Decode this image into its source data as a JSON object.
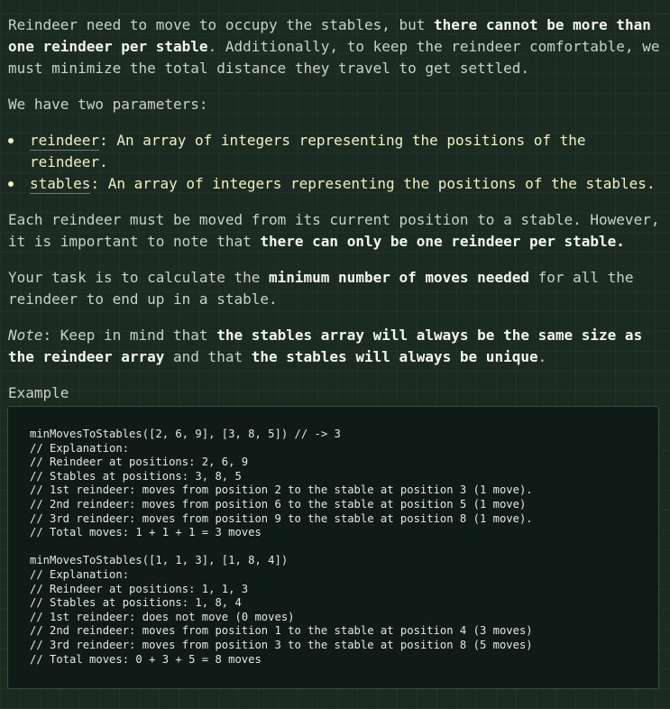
{
  "paragraph1": {
    "text_a": "Reindeer need to move to occupy the stables, but ",
    "bold_a": "there cannot be more than one reindeer per stable",
    "text_b": ". Additionally, to keep the reindeer comfortable, we must minimize the total distance they travel to get settled."
  },
  "paragraph2": {
    "text": "We have two parameters:"
  },
  "params": [
    {
      "code": "reindeer",
      "text": ": An array of integers representing the positions of the reindeer."
    },
    {
      "code": "stables",
      "text": ": An array of integers representing the positions of the stables."
    }
  ],
  "paragraph3": {
    "text_a": "Each reindeer must be moved from its current position to a stable. However, it is important to note that ",
    "bold_a": "there can only be one reindeer per stable."
  },
  "paragraph4": {
    "text_a": "Your task is to calculate the ",
    "bold_a": "minimum number of moves needed",
    "text_b": " for all the reindeer to end up in a stable."
  },
  "paragraph5": {
    "italic": "Note",
    "text_a": ": Keep in mind that ",
    "bold_a": "the stables array will always be the same size as the reindeer array",
    "text_b": " and that ",
    "bold_b": "the stables will always be unique",
    "text_c": "."
  },
  "example_label": "Example",
  "code_lines": [
    "minMovesToStables([2, 6, 9], [3, 8, 5]) // -> 3",
    "// Explanation:",
    "// Reindeer at positions: 2, 6, 9",
    "// Stables at positions: 3, 8, 5",
    "// 1st reindeer: moves from position 2 to the stable at position 3 (1 move).",
    "// 2nd reindeer: moves from position 6 to the stable at position 5 (1 move)",
    "// 3rd reindeer: moves from position 9 to the stable at position 8 (1 move).",
    "// Total moves: 1 + 1 + 1 = 3 moves",
    "",
    "minMovesToStables([1, 1, 3], [1, 8, 4])",
    "// Explanation:",
    "// Reindeer at positions: 1, 1, 3",
    "// Stables at positions: 1, 8, 4",
    "// 1st reindeer: does not move (0 moves)",
    "// 2nd reindeer: moves from position 1 to the stable at position 4 (3 moves)",
    "// 3rd reindeer: moves from position 3 to the stable at position 8 (5 moves)",
    "// Total moves: 0 + 3 + 5 = 8 moves"
  ]
}
